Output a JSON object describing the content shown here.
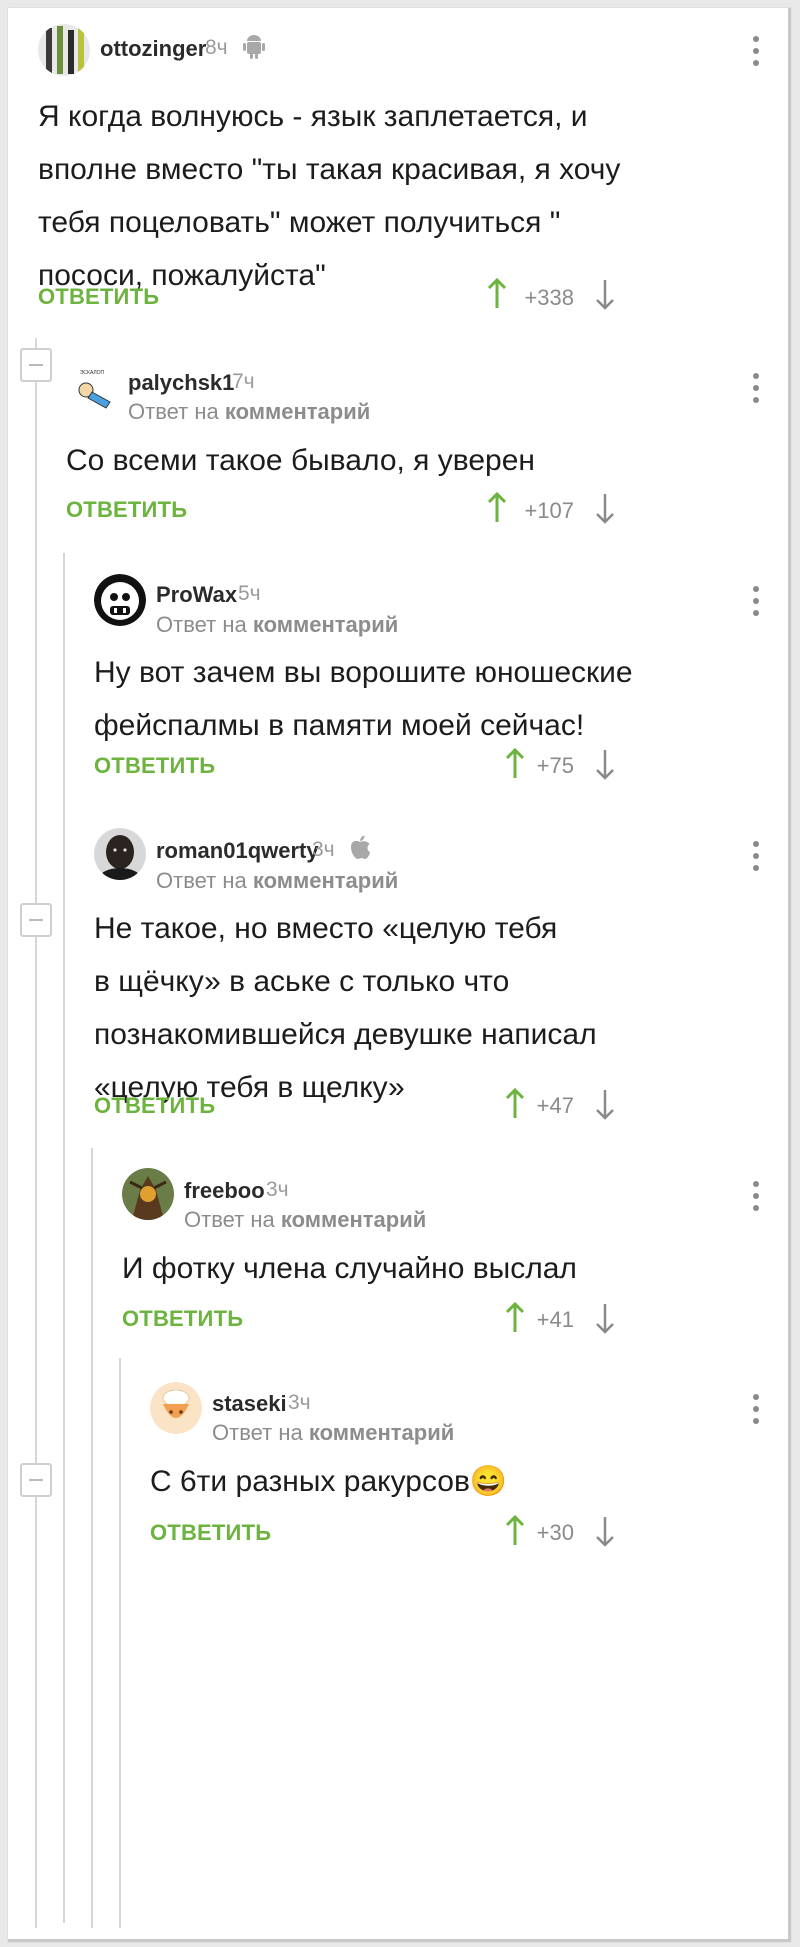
{
  "labels": {
    "reply": "ОТВЕТИТЬ",
    "reply_to_prefix": "Ответ на",
    "reply_to_link": "комментарий"
  },
  "colors": {
    "accent_green": "#6cb33f",
    "username": "#2b2b2b",
    "meta_gray": "#9a9a9a"
  },
  "comments": [
    {
      "username": "ottozinger",
      "time": "8ч",
      "platform_icon": "android-icon",
      "text": "Я когда волнуюсь - язык заплетается, и\nвполне вместо \"ты такая красивая, я хочу\nтебя поцеловать\" может получиться \"\nпососи, пожалуйста\"",
      "score": "+338"
    },
    {
      "username": "palychsk1",
      "time": "7ч",
      "text": "Со всеми такое бывало, я уверен",
      "score": "+107"
    },
    {
      "username": "ProWax",
      "time": "5ч",
      "text": "Ну вот зачем вы ворошите юношеские\nфейспалмы в памяти моей сейчас!",
      "score": "+75"
    },
    {
      "username": "roman01qwerty",
      "time": "3ч",
      "platform_icon": "apple-icon",
      "text": "Не такое, но вместо «целую тебя\nв щёчку» в аське с только что\nпознакомившейся девушке написал\n«целую тебя в щелку»",
      "score": "+47"
    },
    {
      "username": "freeboo",
      "time": "3ч",
      "text": "И фотку члена случайно выслал",
      "score": "+41"
    },
    {
      "username": "staseki",
      "time": "3ч",
      "text": "С 6ти разных ракурсов😄",
      "score": "+30"
    }
  ]
}
